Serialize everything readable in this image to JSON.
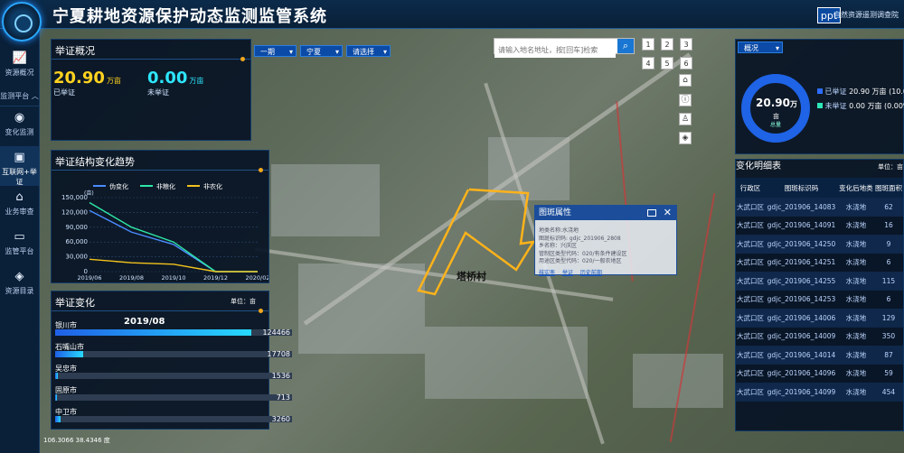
{
  "header": {
    "title": "宁夏耕地资源保护动态监测监管系统",
    "brand": "ppt",
    "org": "自然资源遥测调查院"
  },
  "nav": {
    "items": [
      {
        "label": "资源概况",
        "icon": "chart-icon"
      },
      {
        "label": "监测平台",
        "icon": "chevron-up-icon"
      },
      {
        "label": "变化监测",
        "icon": "radar-icon"
      },
      {
        "label": "互联网+举证",
        "icon": "video-icon"
      },
      {
        "label": "业务审查",
        "icon": "home-icon"
      },
      {
        "label": "监管平台",
        "icon": "monitor-icon"
      },
      {
        "label": "资源目录",
        "icon": "layers-icon"
      }
    ]
  },
  "overview": {
    "title": "举证概况",
    "filters": {
      "period": "一期",
      "region": "宁夏",
      "choose": "请选择"
    },
    "proven_value": "20.90",
    "proven_unit": "万亩",
    "proven_label": "已举证",
    "unproven_value": "0.00",
    "unproven_unit": "万亩",
    "unproven_label": "未举证"
  },
  "trend": {
    "title": "举证结构变化趋势",
    "legend": [
      "伪变化",
      "非粮化",
      "非农化"
    ],
    "yunit": "(亩)"
  },
  "change": {
    "title": "举证变化",
    "unit": "单位：亩",
    "period": "2019/08"
  },
  "search": {
    "placeholder": "请输入地名地址，按[回车]检索",
    "nums": [
      "1",
      "2",
      "3",
      "4",
      "5",
      "6"
    ]
  },
  "popup": {
    "title": "图斑属性",
    "rows": [
      "地类名称:水浇地",
      "图斑标识码: gdjc_201906_2808",
      "乡名称：兴庆区",
      "管制区类型代码：020/有条件建设区",
      "用途区类型代码：020/一般农地区"
    ],
    "links": [
      "核实率",
      "举证",
      "历史前期"
    ]
  },
  "map": {
    "label": "塔桥村",
    "coords": "106.3066 38.4346 度"
  },
  "status": {
    "dropdown": "概况",
    "donut_value": "20.90",
    "donut_unit1": "万",
    "donut_unit2": "亩",
    "donut_label": "总量",
    "legend": [
      {
        "label": "已举证",
        "value": "20.90 万亩 (10.0",
        "color": "#2d6cff"
      },
      {
        "label": "未举证",
        "value": "0.00 万亩 (0.00%",
        "color": "#2ee8b8"
      }
    ]
  },
  "detail": {
    "title": "变化明细表",
    "unit": "单位：亩",
    "headers": [
      "行政区",
      "图斑标识码",
      "变化后地类",
      "图斑面积"
    ],
    "rows": [
      [
        "大武口区",
        "gdjc_201906_14083",
        "水浇地",
        "62"
      ],
      [
        "大武口区",
        "gdjc_201906_14091",
        "水浇地",
        "16"
      ],
      [
        "大武口区",
        "gdjc_201906_14250",
        "水浇地",
        "9"
      ],
      [
        "大武口区",
        "gdjc_201906_14251",
        "水浇地",
        "6"
      ],
      [
        "大武口区",
        "gdjc_201906_14255",
        "水浇地",
        "115"
      ],
      [
        "大武口区",
        "gdjc_201906_14253",
        "水浇地",
        "6"
      ],
      [
        "大武口区",
        "gdjc_201906_14006",
        "水浇地",
        "129"
      ],
      [
        "大武口区",
        "gdjc_201906_14009",
        "水浇地",
        "350"
      ],
      [
        "大武口区",
        "gdjc_201906_14014",
        "水浇地",
        "87"
      ],
      [
        "大武口区",
        "gdjc_201906_14096",
        "水浇地",
        "59"
      ],
      [
        "大武口区",
        "gdjc_201906_14099",
        "水浇地",
        "454"
      ]
    ]
  },
  "chart_data": [
    {
      "type": "line",
      "title": "举证结构变化趋势",
      "ylabel": "(亩)",
      "x": [
        "2019/06",
        "2019/08",
        "2019/10",
        "2019/12",
        "2020/02"
      ],
      "ylim": [
        0,
        150000
      ],
      "yticks": [
        "0",
        "30,000",
        "60,000",
        "90,000",
        "120,000",
        "150,000"
      ],
      "series": [
        {
          "name": "伪变化",
          "color": "#4a8cff",
          "values": [
            124000,
            80000,
            55000,
            0,
            0
          ]
        },
        {
          "name": "非粮化",
          "color": "#2ee8a8",
          "values": [
            140000,
            90000,
            60000,
            0,
            0
          ]
        },
        {
          "name": "非农化",
          "color": "#f2c21c",
          "values": [
            25000,
            18000,
            15000,
            0,
            0
          ]
        }
      ]
    },
    {
      "type": "bar",
      "title": "举证变化",
      "categories": [
        "银川市",
        "石嘴山市",
        "吴忠市",
        "固原市",
        "中卫市"
      ],
      "values": [
        124466,
        17708,
        1536,
        713,
        3260
      ],
      "ylim": [
        0,
        150000
      ]
    }
  ]
}
